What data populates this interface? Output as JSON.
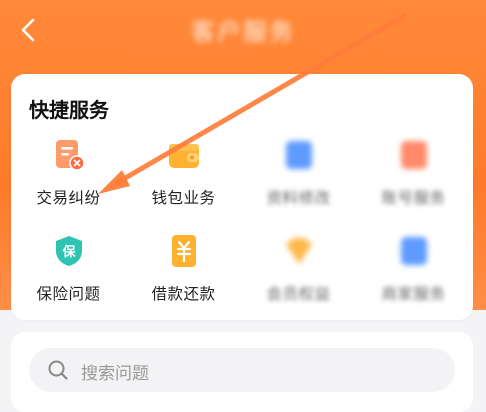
{
  "header": {
    "title": "客户服务",
    "back_icon": "chevron-left-icon"
  },
  "quick_services": {
    "title": "快捷服务",
    "items": [
      {
        "label": "交易纠纷",
        "icon": "bill-dispute-icon"
      },
      {
        "label": "钱包业务",
        "icon": "wallet-icon"
      },
      {
        "label": "资料修改",
        "icon": "profile-icon"
      },
      {
        "label": "账号服务",
        "icon": "account-icon"
      },
      {
        "label": "保险问题",
        "icon": "insurance-shield-icon"
      },
      {
        "label": "借款还款",
        "icon": "loan-yuan-icon"
      },
      {
        "label": "会员权益",
        "icon": "membership-icon"
      },
      {
        "label": "商家服务",
        "icon": "merchant-icon"
      }
    ]
  },
  "search": {
    "placeholder": "搜索问题",
    "icon": "search-icon"
  },
  "colors": {
    "brand_orange": "#ff7a2a",
    "annotation_arrow": "#ff7d3a"
  }
}
